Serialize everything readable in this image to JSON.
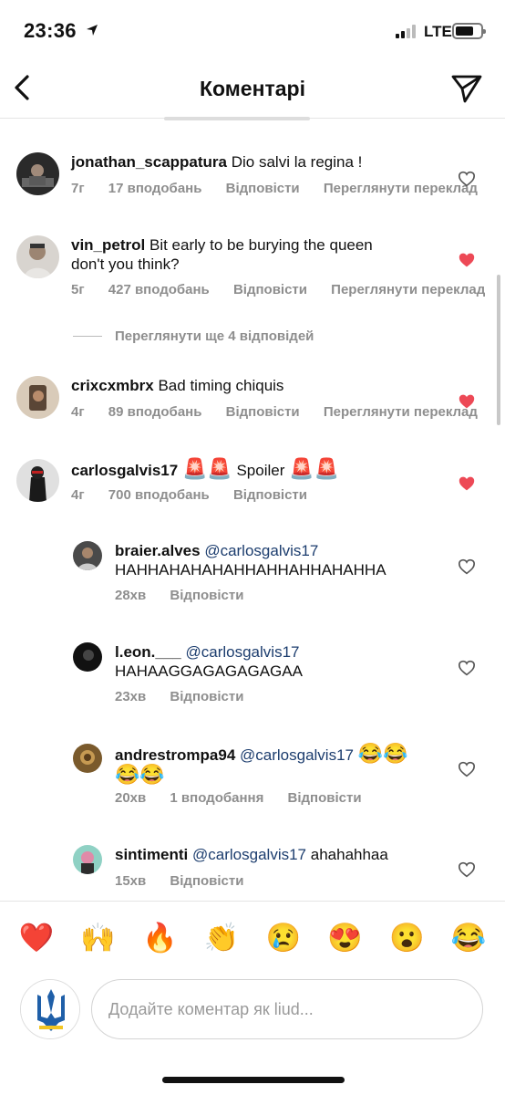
{
  "status": {
    "time": "23:36",
    "network": "LTE"
  },
  "header": {
    "title": "Коментарі"
  },
  "comments": [
    {
      "user": "jonathan_scappatura",
      "text": "Dio salvi la regina !",
      "age": "7г",
      "likes": "17 вподобань",
      "reply": "Відповісти",
      "translate": "Переглянути переклад",
      "liked": false
    },
    {
      "user": "vin_petrol",
      "text": "Bit early to be burying the queen",
      "text2": "don't you think?",
      "age": "5г",
      "likes": "427 вподобань",
      "reply": "Відповісти",
      "translate": "Переглянути переклад",
      "liked": true
    },
    {
      "user": "crixcxmbrx",
      "text": "Bad timing chiquis",
      "age": "4г",
      "likes": "89 вподобань",
      "reply": "Відповісти",
      "translate": "Переглянути переклад",
      "liked": true
    },
    {
      "user": "carlosgalvis17",
      "emoji_a": "🚨🚨",
      "text": "Spoiler",
      "emoji_b": "🚨🚨",
      "age": "4г",
      "likes": "700 вподобань",
      "reply": "Відповісти",
      "liked": true
    }
  ],
  "more_replies": "Переглянути ще 4 відповідей",
  "replies": [
    {
      "user": "braier.alves",
      "mention": "@carlosgalvis17",
      "text": "HAHHAHAHAHAHHAHHAHHAHAHHA",
      "age": "28хв",
      "reply": "Відповісти"
    },
    {
      "user": "l.eon.___",
      "mention": "@carlosgalvis17",
      "text": "HAHAAGGAGAGAGAGAA",
      "age": "23хв",
      "reply": "Відповісти"
    },
    {
      "user": "andrestrompa94",
      "mention": "@carlosgalvis17",
      "emoji_a": "😂😂",
      "emoji_b": "😂😂",
      "age": "20хв",
      "likes": "1 вподобання",
      "reply": "Відповісти"
    },
    {
      "user": "sintimenti",
      "mention": "@carlosgalvis17",
      "text": "ahahahhaa",
      "age": "15хв",
      "reply": "Відповісти"
    }
  ],
  "emoji_bar": [
    "❤️",
    "🙌",
    "🔥",
    "👏",
    "😢",
    "😍",
    "😮",
    "😂"
  ],
  "input": {
    "placeholder": "Додайте коментар як liud..."
  },
  "colors": {
    "like_red": "#ed4956",
    "muted_text": "#8e8e8e",
    "mention_blue": "#1c3d6e",
    "avatar_ua_blue": "#1f5fa8",
    "avatar_ua_yellow": "#f3c623"
  }
}
